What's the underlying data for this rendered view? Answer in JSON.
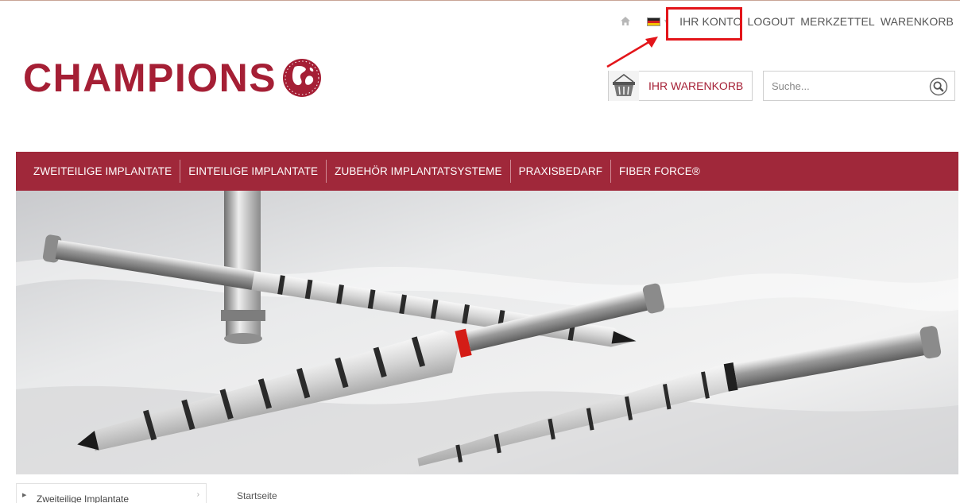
{
  "topnav": {
    "links": [
      "IHR KONTO",
      "LOGOUT",
      "MERKZETTEL",
      "WARENKORB"
    ]
  },
  "logo": {
    "text": "CHAMPIONS"
  },
  "cart": {
    "label": "IHR WARENKORB"
  },
  "search": {
    "placeholder": "Suche..."
  },
  "mainnav": {
    "items": [
      "ZWEITEILIGE IMPLANTATE",
      "EINTEILIGE IMPLANTATE",
      "ZUBEHÖR IMPLANTATSYSTEME",
      "PRAXISBEDARF",
      "FIBER FORCE®"
    ]
  },
  "sidebar": {
    "items": [
      "Zweiteilige Implantate"
    ]
  },
  "breadcrumb": {
    "label": "Startseite"
  },
  "colors": {
    "brand": "#a51f35",
    "nav_background": "#a0283a",
    "annotation": "#e3151a"
  },
  "icons": [
    "home-icon",
    "german-flag-icon",
    "chevron-down-icon",
    "basket-icon",
    "search-icon",
    "globe-icon",
    "chevron-right-icon"
  ]
}
